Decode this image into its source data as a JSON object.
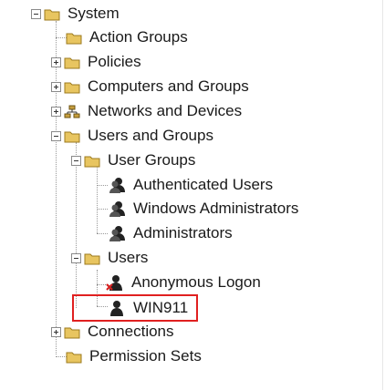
{
  "tree": {
    "root_label": "System",
    "items": {
      "action_groups": "Action Groups",
      "policies": "Policies",
      "computers_and_groups": "Computers and Groups",
      "networks_and_devices": "Networks and Devices",
      "users_and_groups": "Users and Groups",
      "user_groups": "User Groups",
      "authenticated_users": "Authenticated Users",
      "windows_administrators": "Windows Administrators",
      "administrators": "Administrators",
      "users": "Users",
      "anonymous_logon": "Anonymous Logon",
      "win911": "WIN911",
      "connections": "Connections",
      "permission_sets": "Permission Sets"
    }
  },
  "colors": {
    "folder": "#e8c560",
    "highlight_box": "#e02020",
    "tree_lines": "#9a9a9a"
  }
}
